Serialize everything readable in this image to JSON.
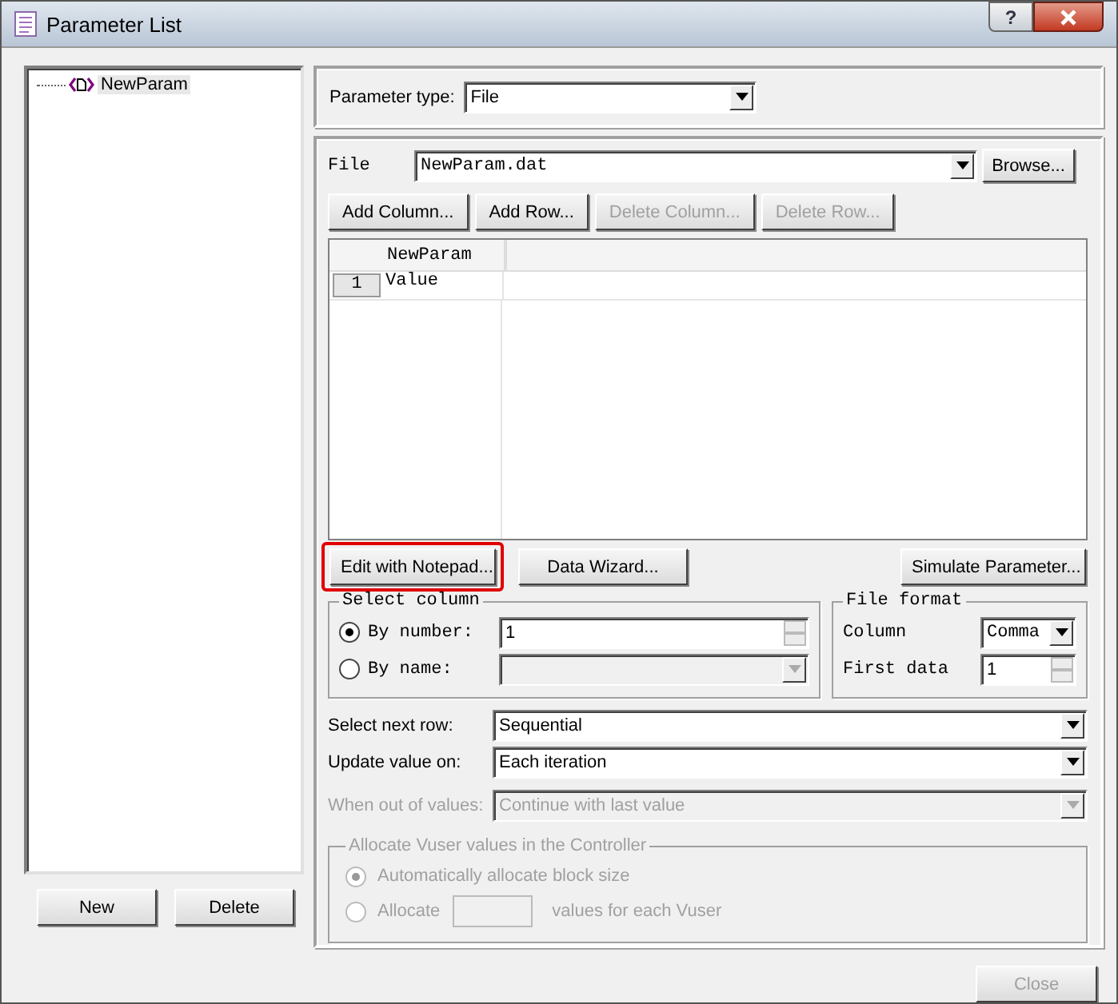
{
  "window": {
    "title": "Parameter List",
    "help_label": "?"
  },
  "tree": [
    {
      "label": "NewParam",
      "selected": true
    }
  ],
  "left_buttons": [
    "New",
    "Delete"
  ],
  "parameter_type": {
    "label": "Parameter type:",
    "value": "File"
  },
  "file": {
    "label": "File",
    "value": "NewParam.dat",
    "browse": "Browse..."
  },
  "table_buttons": [
    {
      "label": "Add Column...",
      "disabled": false
    },
    {
      "label": "Add Row...",
      "disabled": false
    },
    {
      "label": "Delete Column...",
      "disabled": true
    },
    {
      "label": "Delete Row...",
      "disabled": true
    }
  ],
  "grid": {
    "columns": [
      "NewParam"
    ],
    "rows": [
      {
        "number": "1",
        "cells": [
          "Value"
        ]
      }
    ]
  },
  "action_buttons": [
    {
      "label": "Edit with Notepad...",
      "highlighted": true
    },
    {
      "label": "Data Wizard...",
      "highlighted": false
    },
    {
      "label": "Simulate Parameter...",
      "highlighted": false
    }
  ],
  "select_column": {
    "title": "Select column",
    "options": [
      {
        "label": "By number:",
        "selected": true,
        "kind": "spin",
        "value": "1",
        "disabled": false
      },
      {
        "label": "By name:",
        "selected": false,
        "kind": "combo",
        "disabled": true
      }
    ]
  },
  "file_format": {
    "title": "File format",
    "fields": [
      {
        "label": "Column",
        "kind": "combo",
        "value": "Comma"
      },
      {
        "label": "First data",
        "kind": "spin",
        "value": "1"
      }
    ]
  },
  "settings": [
    {
      "label": "Select next row:",
      "value": "Sequential",
      "disabled": false
    },
    {
      "label": "Update value on:",
      "value": "Each iteration",
      "disabled": false
    },
    {
      "label": "When out of values:",
      "value": "Continue with last value",
      "disabled": true
    }
  ],
  "allocate": {
    "title": "Allocate Vuser values in the Controller",
    "disabled": true,
    "options": [
      {
        "kind": "plain",
        "label": "Automatically allocate block size",
        "selected": true
      },
      {
        "kind": "count",
        "label": "Allocate",
        "suffix": "values for each Vuser",
        "selected": false
      }
    ]
  },
  "footer_buttons": [
    {
      "label": "Close",
      "disabled": true
    }
  ]
}
